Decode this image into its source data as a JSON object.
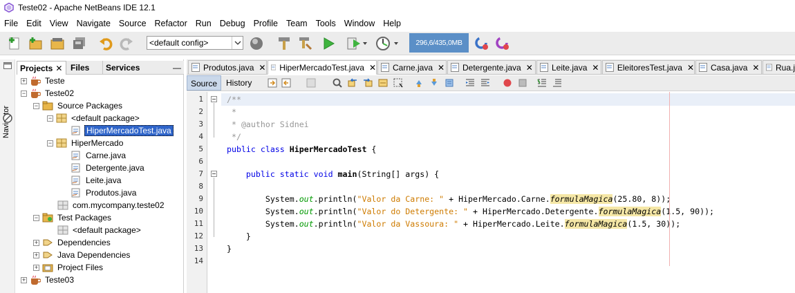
{
  "window": {
    "title": "Teste02 - Apache NetBeans IDE 12.1"
  },
  "menu": [
    "File",
    "Edit",
    "View",
    "Navigate",
    "Source",
    "Refactor",
    "Run",
    "Debug",
    "Profile",
    "Team",
    "Tools",
    "Window",
    "Help"
  ],
  "toolbar": {
    "config_value": "<default config>",
    "memory": "296,6/435,0MB",
    "icons": [
      "new-file-icon",
      "new-project-icon",
      "open-project-icon",
      "save-all-icon",
      "undo-icon",
      "redo-icon",
      "globe-icon",
      "build-icon",
      "clean-build-icon",
      "run-icon",
      "debug-icon",
      "profile-icon",
      "gc-icon",
      "profile-gc-icon"
    ]
  },
  "navigator": {
    "label": "Navigator"
  },
  "project_panel": {
    "tabs": [
      {
        "label": "Projects",
        "close": "✕"
      },
      {
        "label": "Files"
      },
      {
        "label": "Services"
      }
    ],
    "minimize": "—",
    "tree": [
      {
        "label": "Teste",
        "expander": "+",
        "icon": "project-icon"
      },
      {
        "label": "Teste02",
        "expander": "−",
        "icon": "project-icon"
      },
      {
        "label": "Source Packages",
        "expander": "−",
        "icon": "source-packages-icon"
      },
      {
        "label": "<default package>",
        "expander": "−",
        "icon": "package-icon"
      },
      {
        "label": "HiperMercadoTest.java",
        "icon": "java-file-icon",
        "selected": true
      },
      {
        "label": "HiperMercado",
        "expander": "−",
        "icon": "package-icon"
      },
      {
        "label": "Carne.java",
        "icon": "java-file-icon"
      },
      {
        "label": "Detergente.java",
        "icon": "java-file-icon"
      },
      {
        "label": "Leite.java",
        "icon": "java-file-icon"
      },
      {
        "label": "Produtos.java",
        "icon": "java-file-icon"
      },
      {
        "label": "com.mycompany.teste02",
        "icon": "package-icon"
      },
      {
        "label": "Test Packages",
        "expander": "−",
        "icon": "test-packages-icon"
      },
      {
        "label": "<default package>",
        "icon": "package-icon"
      },
      {
        "label": "Dependencies",
        "expander": "+",
        "icon": "dependencies-icon"
      },
      {
        "label": "Java Dependencies",
        "expander": "+",
        "icon": "dependencies-icon"
      },
      {
        "label": "Project Files",
        "expander": "+",
        "icon": "project-files-icon"
      },
      {
        "label": "Teste03",
        "expander": "+",
        "icon": "project-icon"
      }
    ]
  },
  "editor_tabs": [
    {
      "label": "Produtos.java",
      "close": "✕"
    },
    {
      "label": "HiperMercadoTest.java",
      "close": "✕",
      "active": true
    },
    {
      "label": "Carne.java",
      "close": "✕"
    },
    {
      "label": "Detergente.java",
      "close": "✕"
    },
    {
      "label": "Leite.java",
      "close": "✕"
    },
    {
      "label": "EleitoresTest.java",
      "close": "✕"
    },
    {
      "label": "Casa.java",
      "close": "✕"
    },
    {
      "label": "Rua.j",
      "close": ""
    }
  ],
  "editor_toolbar": {
    "source_label": "Source",
    "history_label": "History"
  },
  "code": {
    "line_numbers": [
      "1",
      "2",
      "3",
      "4",
      "5",
      "6",
      "7",
      "8",
      "9",
      "10",
      "11",
      "12",
      "13",
      "14"
    ],
    "l1": "/**",
    "l2": " *",
    "l3": " * @author Sidnei",
    "l4": " */",
    "l5": [
      "public class ",
      "HiperMercadoTest",
      " {"
    ],
    "l7": [
      "    public static void ",
      "main",
      "(String[] args) {"
    ],
    "l9": [
      "        System.",
      "out",
      ".println(",
      "\"Valor da Carne: \"",
      " + HiperMercado.Carne.",
      "formulaMagica",
      "(25.80, 8));"
    ],
    "l10": [
      "        System.",
      "out",
      ".println(",
      "\"Valor do Detergente: \"",
      " + HiperMercado.Detergente.",
      "formulaMagica",
      "(1.5, 90));"
    ],
    "l11": [
      "        System.",
      "out",
      ".println(",
      "\"Valor da Vassoura: \"",
      " + HiperMercado.Leite.",
      "formulaMagica",
      "(1.5, 30));"
    ],
    "l12": "    }",
    "l13": "}"
  }
}
